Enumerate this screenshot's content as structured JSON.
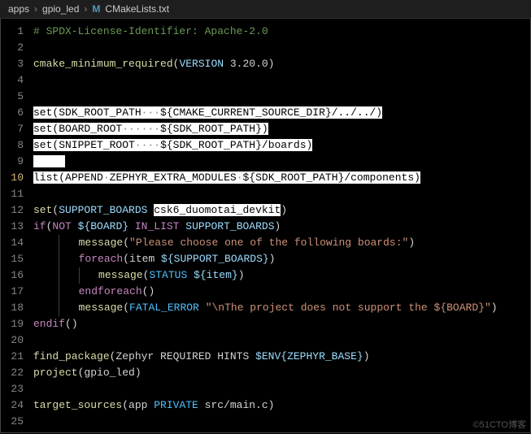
{
  "breadcrumb": {
    "seg1": "apps",
    "seg2": "gpio_led",
    "icon": "M",
    "file": "CMakeLists.txt",
    "sep": "›"
  },
  "watermark": "©51CTO博客",
  "lines": {
    "l1": "# SPDX-License-Identifier: Apache-2.0",
    "l3a": "cmake_minimum_required",
    "l3b": "(",
    "l3c": "VERSION",
    "l3d": " 3.20.0)",
    "l6a": "set",
    "l6b": "(",
    "l6c": "SDK_ROOT_PATH",
    "l6d": "···",
    "l6e": "${CMAKE_CURRENT_SOURCE_DIR}",
    "l6f": "/../../)",
    "l7a": "set",
    "l7b": "(",
    "l7c": "BOARD_ROOT",
    "l7d": "······",
    "l7e": "${SDK_ROOT_PATH}",
    "l7f": ")",
    "l8a": "set",
    "l8b": "(",
    "l8c": "SNIPPET_ROOT",
    "l8d": "····",
    "l8e": "${SDK_ROOT_PATH}",
    "l8f": "/boards)",
    "l10a": "list",
    "l10b": "(",
    "l10c": "APPEND",
    "l10d": "·",
    "l10e": "ZEPHYR_EXTRA_MODULES",
    "l10f": "·",
    "l10g": "${SDK_ROOT_PATH}",
    "l10h": "/components)",
    "l12a": "set",
    "l12b": "(",
    "l12c": "SUPPORT_BOARDS",
    "l12d": " ",
    "l12e": "csk6_duomotai_devkit",
    "l12f": ")",
    "l13a": "if",
    "l13b": "(",
    "l13c": "NOT",
    "l13d": " ",
    "l13e": "${BOARD}",
    "l13f": " ",
    "l13g": "IN_LIST",
    "l13h": " ",
    "l13i": "SUPPORT_BOARDS",
    "l13j": ")",
    "l14a": "message",
    "l14b": "(",
    "l14c": "\"Please choose one of the following boards:\"",
    "l14d": ")",
    "l15a": "foreach",
    "l15b": "(item ",
    "l15c": "${SUPPORT_BOARDS}",
    "l15d": ")",
    "l16a": "message",
    "l16b": "(",
    "l16c": "STATUS",
    "l16d": " ",
    "l16e": "${item}",
    "l16f": ")",
    "l17a": "endforeach",
    "l17b": "()",
    "l18a": "message",
    "l18b": "(",
    "l18c": "FATAL_ERROR",
    "l18d": " ",
    "l18e": "\"\\nThe project does not support the ${BOARD}\"",
    "l18f": ")",
    "l19a": "endif",
    "l19b": "()",
    "l21a": "find_package",
    "l21b": "(Zephyr REQUIRED HINTS ",
    "l21c": "$ENV{ZEPHYR_BASE}",
    "l21d": ")",
    "l22a": "project",
    "l22b": "(gpio_led)",
    "l24a": "target_sources",
    "l24b": "(app ",
    "l24c": "PRIVATE",
    "l24d": " src/main.c)"
  },
  "line_numbers": [
    "1",
    "2",
    "3",
    "4",
    "5",
    "6",
    "7",
    "8",
    "9",
    "10",
    "11",
    "12",
    "13",
    "14",
    "15",
    "16",
    "17",
    "18",
    "19",
    "20",
    "21",
    "22",
    "23",
    "24",
    "25"
  ]
}
